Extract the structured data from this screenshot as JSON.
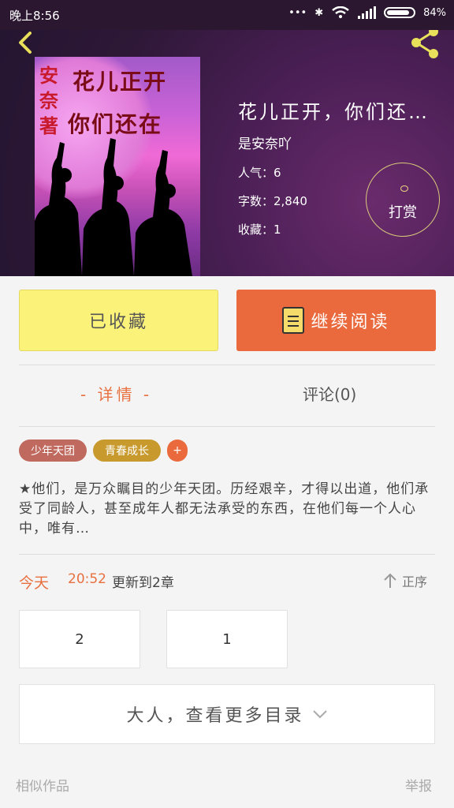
{
  "status_bar": {
    "time": "晚上8:56",
    "battery": "84%"
  },
  "book": {
    "title": "花儿正开，你们还…",
    "author": "是安奈吖",
    "popularity": "人气：6",
    "word_count": "字数：2,840",
    "favorites": "收藏：1",
    "tip_label": "打赏"
  },
  "cover": {
    "author_text": "安奈著",
    "title_line1": "花儿正开",
    "title_line2": "你们还在"
  },
  "actions": {
    "collected_label": "已收藏",
    "continue_label": "继续阅读"
  },
  "tabs": {
    "detail": "- 详情 -",
    "comment": "评论(0)"
  },
  "tags": [
    {
      "label": "少年天团",
      "color": "#c0695f"
    },
    {
      "label": "青春成长",
      "color": "#c89a2e"
    }
  ],
  "tag_add": "+",
  "description": "★他们，是万众瞩目的少年天团。历经艰辛，才得以出道，他们承受了同龄人，甚至成年人都无法承受的东西，在他们每一个人心中，唯有…",
  "update": {
    "day": "今天",
    "time": "20:52",
    "text": "更新到2章"
  },
  "sort_label": "正序",
  "chapters": [
    "2",
    "1"
  ],
  "more_catalog": "大人，查看更多目录",
  "footer": {
    "similar": "相似作品",
    "report": "举报"
  },
  "colors": {
    "accent": "#ea6a3d",
    "collected_bg": "#fbf27a"
  }
}
